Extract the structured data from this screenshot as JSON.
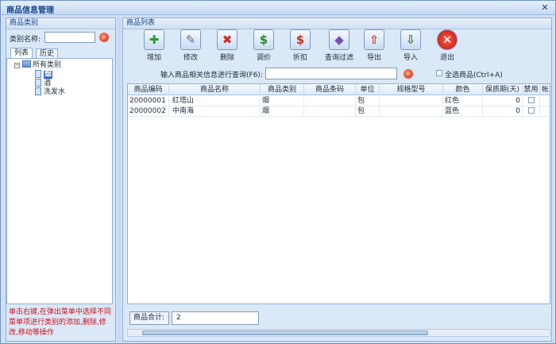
{
  "window": {
    "title": "商品信息管理"
  },
  "left": {
    "header": "商品类别",
    "category_label": "类别名称:",
    "category_value": "",
    "tabs": [
      "列表",
      "历史"
    ],
    "tree": {
      "root": "所有类别",
      "children": [
        "烟",
        "酒",
        "洗发水"
      ]
    },
    "hint": "单击右键,在弹出菜单中选择不同菜单项进行类别的添加,删除,修改,移动等操作"
  },
  "right": {
    "header": "商品列表",
    "toolbar": [
      "增加",
      "修改",
      "删除",
      "调价",
      "折扣",
      "查询过滤",
      "导出",
      "导入",
      "退出"
    ],
    "search_label": "输入商品相关信息进行查询(F6):",
    "search_value": "",
    "select_all_label": "全选商品(Ctrl+A)",
    "columns": [
      "商品编码",
      "商品名称",
      "商品类别",
      "商品条码",
      "单位",
      "规格型号",
      "颜色",
      "保质期(天)",
      "禁用",
      "帐"
    ],
    "rows": [
      [
        "20000001",
        "红塔山",
        "烟",
        "",
        "包",
        "",
        "红色",
        "0",
        ""
      ],
      [
        "20000002",
        "中南海",
        "烟",
        "",
        "包",
        "",
        "蓝色",
        "0",
        ""
      ]
    ],
    "total_label": "商品合计:",
    "total_value": "2"
  },
  "colors": {
    "accent": "#15428b",
    "hint": "#d4101a",
    "selection": "#2b62c5"
  }
}
